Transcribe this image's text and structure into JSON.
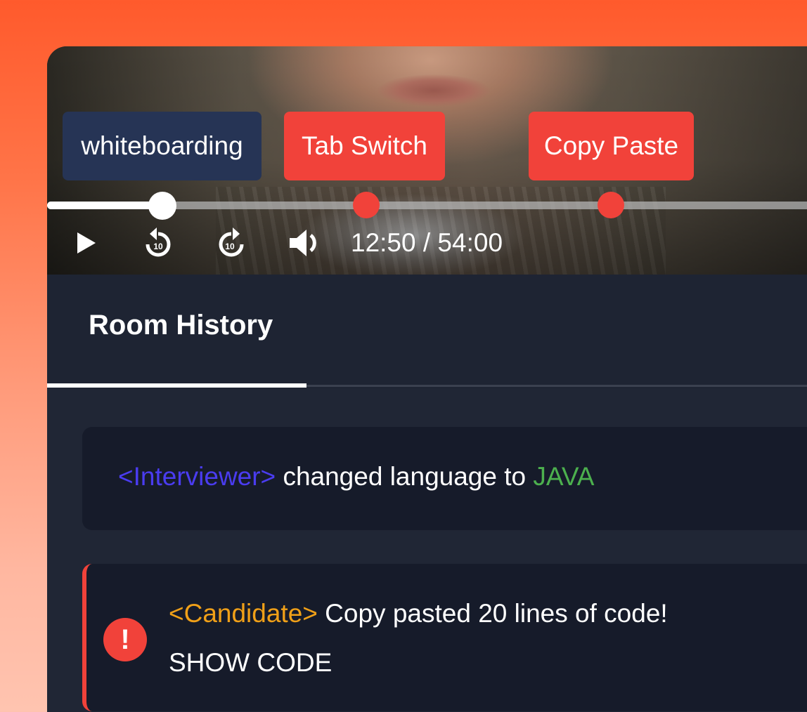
{
  "player": {
    "markers": [
      {
        "label": "whiteboarding",
        "color": "#263455"
      },
      {
        "label": "Tab Switch",
        "color": "#f1423a"
      },
      {
        "label": "Copy Paste",
        "color": "#f1423a"
      }
    ],
    "progress": 0.149,
    "event_points": [
      0.413,
      0.729
    ],
    "time_display": "12:50 / 54:00",
    "controls": {
      "play_icon": "play-icon",
      "rewind_icon": "rewind-10-icon",
      "rewind_label": "10",
      "forward_icon": "forward-10-icon",
      "forward_label": "10",
      "volume_icon": "volume-icon"
    }
  },
  "tabs": {
    "active_label": "Room History"
  },
  "history": [
    {
      "actor": "<Interviewer>",
      "message": " changed language to ",
      "value": "JAVA"
    },
    {
      "icon": "alert-icon",
      "icon_glyph": "!",
      "actor": "<Candidate>",
      "message": " Copy pasted 20 lines of code!",
      "action": "SHOW CODE"
    }
  ],
  "colors": {
    "accent_red": "#f1423a",
    "interviewer": "#4a3cf0",
    "candidate": "#f0a018",
    "language": "#4cb04e",
    "panel": "#1e2433"
  }
}
